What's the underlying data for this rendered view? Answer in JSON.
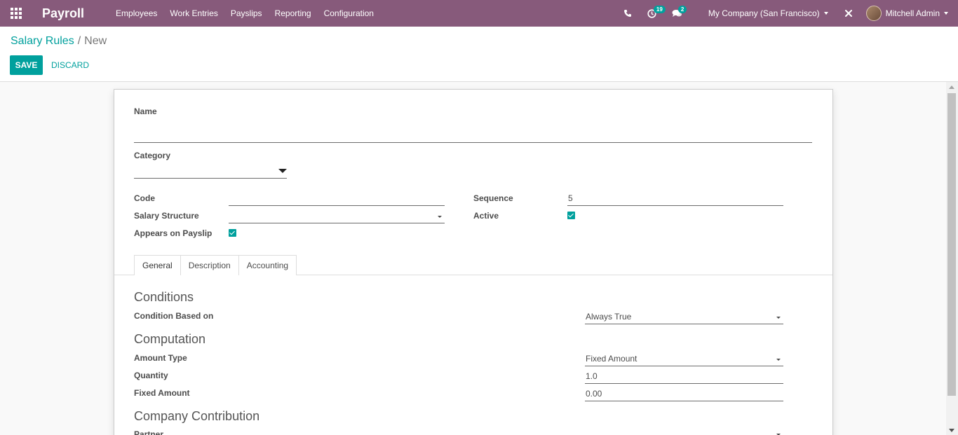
{
  "navbar": {
    "app_name": "Payroll",
    "menu": [
      "Employees",
      "Work Entries",
      "Payslips",
      "Reporting",
      "Configuration"
    ],
    "activity_badge": "19",
    "messages_badge": "2",
    "company": "My Company (San Francisco)",
    "user": "Mitchell Admin",
    "icons": [
      "apps-icon",
      "phone-icon",
      "activity-clock-icon",
      "chat-icon",
      "debug-tools-icon"
    ]
  },
  "breadcrumb": {
    "parent": "Salary Rules",
    "separator": "/",
    "current": "New"
  },
  "buttons": {
    "save": "SAVE",
    "discard": "DISCARD"
  },
  "form": {
    "name_label": "Name",
    "name_value": "",
    "category_label": "Category",
    "category_value": "",
    "code_label": "Code",
    "code_value": "",
    "salary_structure_label": "Salary Structure",
    "salary_structure_value": "",
    "appears_on_payslip_label": "Appears on Payslip",
    "appears_on_payslip_checked": true,
    "sequence_label": "Sequence",
    "sequence_value": "5",
    "active_label": "Active",
    "active_checked": true
  },
  "tabs": [
    "General",
    "Description",
    "Accounting"
  ],
  "active_tab": "General",
  "general": {
    "conditions_title": "Conditions",
    "condition_based_on_label": "Condition Based on",
    "condition_based_on_value": "Always True",
    "computation_title": "Computation",
    "amount_type_label": "Amount Type",
    "amount_type_value": "Fixed Amount",
    "quantity_label": "Quantity",
    "quantity_value": "1.0",
    "fixed_amount_label": "Fixed Amount",
    "fixed_amount_value": "0.00",
    "company_contribution_title": "Company Contribution",
    "partner_label": "Partner",
    "partner_value": ""
  },
  "colors": {
    "navbar": "#875a7b",
    "accent": "#00a09d",
    "background": "#f9f9f9"
  }
}
